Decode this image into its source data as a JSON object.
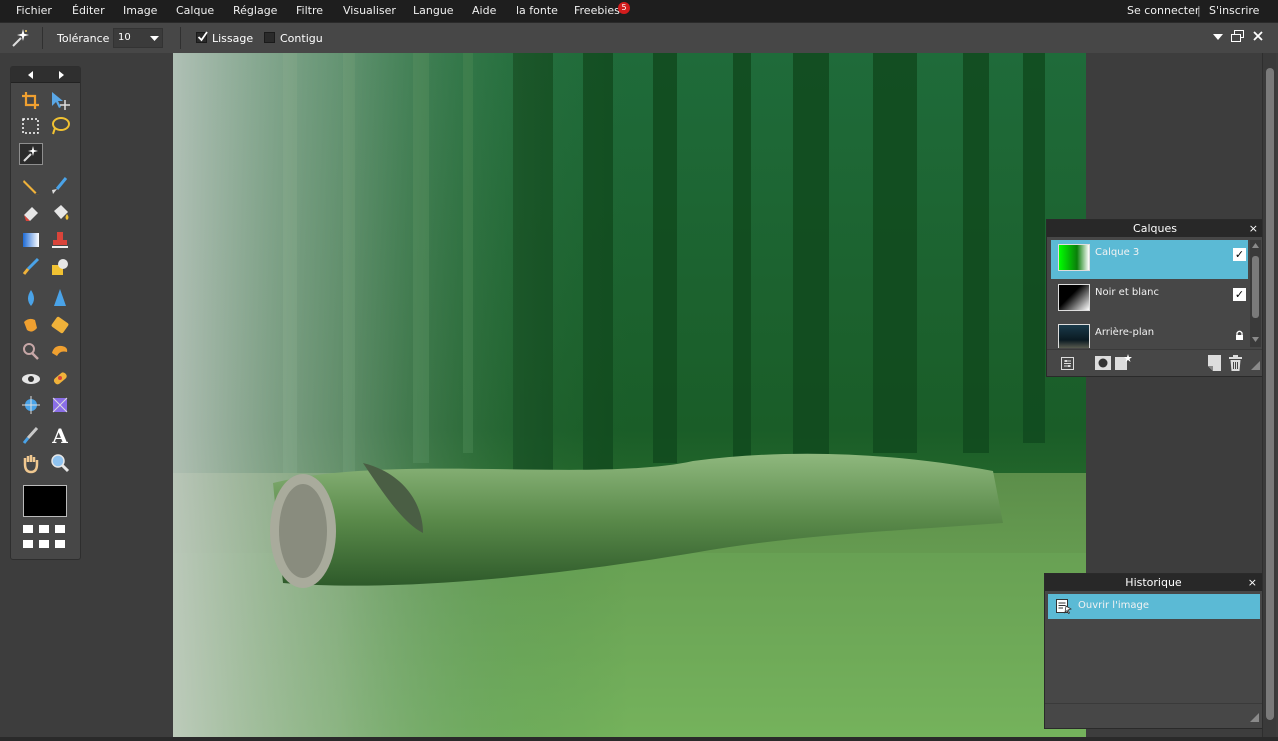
{
  "menu": {
    "items": [
      "Fichier",
      "Éditer",
      "Image",
      "Calque",
      "Réglage",
      "Filtre",
      "Visualiser",
      "Langue",
      "Aide",
      "la fonte",
      "Freebies"
    ],
    "badge": "5",
    "login": "Se connecter",
    "divider": "|",
    "signup": "S'inscrire"
  },
  "options": {
    "tolerance_label": "Tolérance :",
    "tolerance_value": "10",
    "smoothing_label": "Lissage",
    "smoothing_checked": true,
    "contiguous_label": "Contigu",
    "contiguous_checked": false
  },
  "tools": [
    "crop-tool",
    "move-tool",
    "marquee-tool",
    "lasso-tool",
    "magic-wand-tool",
    "pencil-tool",
    "brush-tool",
    "eraser-tool",
    "bucket-tool",
    "gradient-tool",
    "stamp-tool",
    "color-replace-tool",
    "drawing-tool",
    "blur-tool",
    "sharpen-tool",
    "smudge-tool",
    "sponge-tool",
    "dodge-tool",
    "burn-tool",
    "red-eye-tool",
    "spot-heal-tool",
    "bloat-tool",
    "pinch-tool",
    "color-picker-tool",
    "type-tool",
    "hand-tool",
    "zoom-tool"
  ],
  "colors": {
    "foreground": "#000000",
    "background": "#ffffff",
    "accent": "#5bbad5",
    "menubar": "#1e1e1e"
  },
  "layers": {
    "title": "Calques",
    "close": "×",
    "items": [
      {
        "name": "Calque 3",
        "visible": true,
        "selected": true
      },
      {
        "name": "Noir et blanc",
        "visible": true,
        "selected": false
      },
      {
        "name": "Arrière-plan",
        "locked": true,
        "selected": false
      }
    ]
  },
  "history": {
    "title": "Historique",
    "close": "×",
    "items": [
      {
        "label": "Ouvrir l'image",
        "selected": true
      }
    ]
  }
}
